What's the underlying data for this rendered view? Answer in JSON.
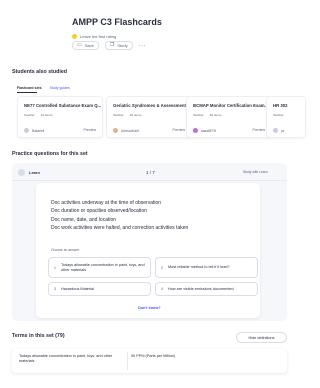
{
  "header": {
    "title": "AMPP C3 Flashcards",
    "rating_text": "Leave the first rating",
    "save_label": "Save",
    "study_label": "Study",
    "more_glyph": "···"
  },
  "students": {
    "heading": "Students also studied",
    "tabs": [
      "Flashcard sets",
      "Study guides"
    ],
    "cards": [
      {
        "title": "NE77 Controlled Substance Exam Q...",
        "kind": "Teacher",
        "terms": "44 terms",
        "author": "Bakariell",
        "preview": "Preview"
      },
      {
        "title": "Geriatric Syndromes & Assessment",
        "kind": "Teacher",
        "terms": "20 terms",
        "author": "AlexsonKaiH",
        "preview": "Preview"
      },
      {
        "title": "BCMAP Monitor Certification Exam...",
        "kind": "Teacher",
        "terms": "84 terms",
        "author": "aaaa8ETH",
        "preview": "Preview"
      },
      {
        "title": "HR 302",
        "kind": "Teacher",
        "terms": "",
        "author": "jor",
        "preview": ""
      }
    ]
  },
  "practice": {
    "heading": "Practice questions for this set",
    "mode": "Learn",
    "progress": "1 / 7",
    "study_with": "Study with Learn",
    "prompt_lines": [
      "Doc activities underway at the time of observation",
      "Doc duration or opacities observed/location",
      "Doc name, date, and location",
      "Doc work activities were halted, and correction activities taken"
    ],
    "choose_label": "Choose an answer",
    "options": [
      {
        "num": "1",
        "text": "Todays allowable concentration in paint, toys, and other materials"
      },
      {
        "num": "2",
        "text": "Most reliable method to tell if it lead?"
      },
      {
        "num": "3",
        "text": "Hazardous Material"
      },
      {
        "num": "4",
        "text": "How are visible emissions documented"
      }
    ],
    "dont_know": "Don't know?"
  },
  "terms": {
    "heading": "Terms in this set (79)",
    "hide_label": "Hide definitions",
    "rows": [
      {
        "term": "Todays allowable concentration in paint, toys, and other materials",
        "definition": "90 PPM (Parts per Million)"
      }
    ]
  }
}
